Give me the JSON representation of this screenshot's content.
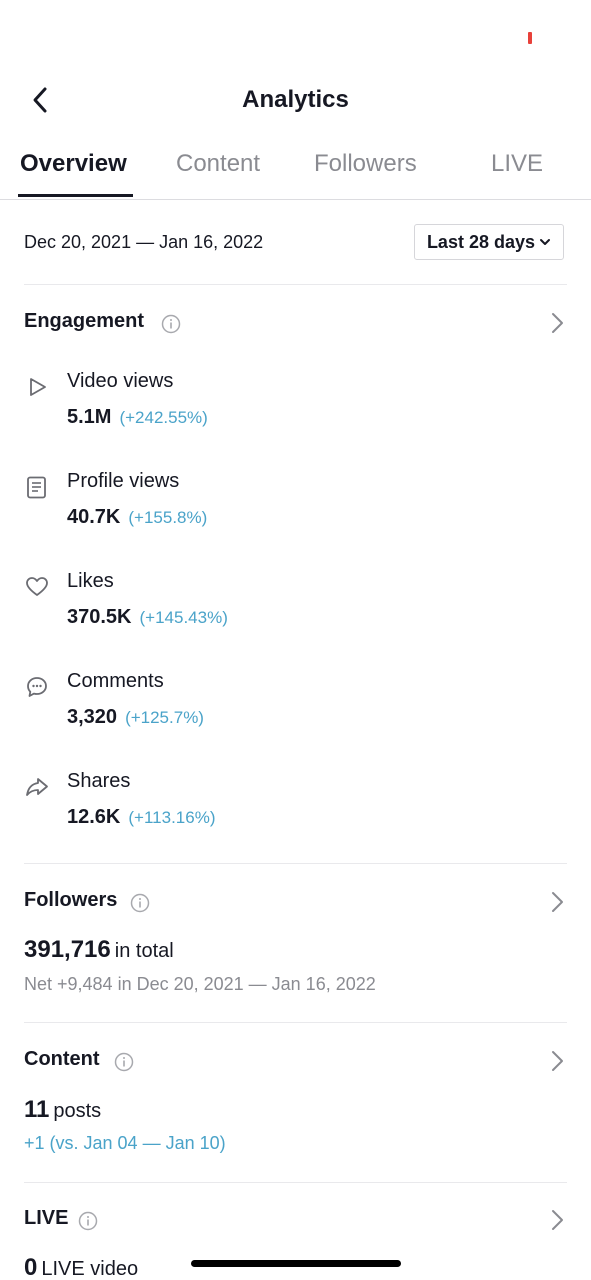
{
  "header": {
    "title": "Analytics",
    "back_icon": "chevron-left-icon"
  },
  "tabs": [
    {
      "label": "Overview",
      "active": true
    },
    {
      "label": "Content",
      "active": false
    },
    {
      "label": "Followers",
      "active": false
    },
    {
      "label": "LIVE",
      "active": false
    }
  ],
  "date_range": "Dec 20, 2021 — Jan 16, 2022",
  "range_select": {
    "value": "Last 28 days"
  },
  "engagement": {
    "title": "Engagement",
    "metrics": [
      {
        "icon": "play-icon",
        "label": "Video views",
        "value": "5.1M",
        "change": "(+242.55%)"
      },
      {
        "icon": "profile-doc-icon",
        "label": "Profile views",
        "value": "40.7K",
        "change": "(+155.8%)"
      },
      {
        "icon": "heart-icon",
        "label": "Likes",
        "value": "370.5K",
        "change": "(+145.43%)"
      },
      {
        "icon": "comment-icon",
        "label": "Comments",
        "value": "3,320",
        "change": "(+125.7%)"
      },
      {
        "icon": "share-icon",
        "label": "Shares",
        "value": "12.6K",
        "change": "(+113.16%)"
      }
    ]
  },
  "followers": {
    "title": "Followers",
    "total": "391,716",
    "total_suffix": "in total",
    "net": "Net +9,484 in Dec 20, 2021 — Jan 16, 2022"
  },
  "content": {
    "title": "Content",
    "count": "11",
    "count_suffix": "posts",
    "compare": "+1 (vs. Jan 04 — Jan 10)"
  },
  "live": {
    "title": "LIVE",
    "count": "0",
    "count_suffix": "LIVE video"
  },
  "colors": {
    "accent_blue": "#4aa3c9",
    "text_primary": "#161823",
    "text_secondary": "#8a8b91",
    "status_red": "#e8413a"
  }
}
